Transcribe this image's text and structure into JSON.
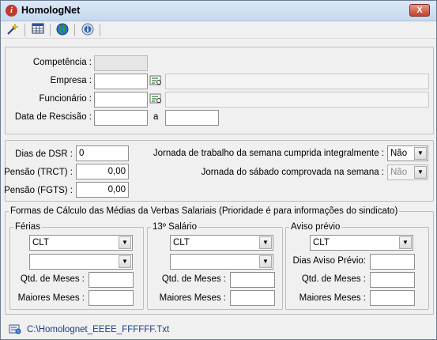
{
  "window": {
    "title": "HomologNet",
    "close_label": "X"
  },
  "toolbar": {
    "items": [
      "wizard-icon",
      "table-icon",
      "globe-icon",
      "info-icon"
    ]
  },
  "header": {
    "competencia_label": "Competência :",
    "empresa_label": "Empresa :",
    "funcionario_label": "Funcionário :",
    "rescisao_label": "Data de Rescisão :",
    "a_label": "a",
    "competencia_value": "",
    "empresa_value": "",
    "funcionario_value": "",
    "rescisao_from": "",
    "rescisao_to": ""
  },
  "dsr": {
    "dias_dsr_label": "Dias de DSR :",
    "dias_dsr_value": "0",
    "pensao_trct_label": "Pensão (TRCT) :",
    "pensao_trct_value": "0,00",
    "pensao_fgts_label": "Pensão (FGTS) :",
    "pensao_fgts_value": "0,00",
    "jornada_semana_label": "Jornada de trabalho da semana cumprida integralmente :",
    "jornada_semana_value": "Não",
    "jornada_sabado_label": "Jornada do sábado comprovada na semana :",
    "jornada_sabado_value": "Não"
  },
  "formas": {
    "legend": "Formas de Cálculo das Médias da Verbas Salariais  (Prioridade é para informações do sindicato)",
    "ferias": {
      "legend": "Férias",
      "tipo": "CLT",
      "forma": "",
      "qtd_label": "Qtd. de Meses :",
      "maiores_label": "Maiores Meses :",
      "qtd_value": "",
      "maiores_value": ""
    },
    "salario13": {
      "legend": "13º Salário",
      "tipo": "CLT",
      "forma": "",
      "qtd_label": "Qtd. de Meses :",
      "maiores_label": "Maiores Meses :",
      "qtd_value": "",
      "maiores_value": ""
    },
    "aviso": {
      "legend": "Aviso prévio",
      "tipo": "CLT",
      "dias_label": "Dias Aviso Prévio:",
      "qtd_label": "Qtd. de Meses :",
      "maiores_label": "Maiores Meses :",
      "dias_value": "",
      "qtd_value": "",
      "maiores_value": ""
    }
  },
  "status": {
    "file_path": "C:\\Homolognet_EEEE_FFFFFF.Txt"
  }
}
